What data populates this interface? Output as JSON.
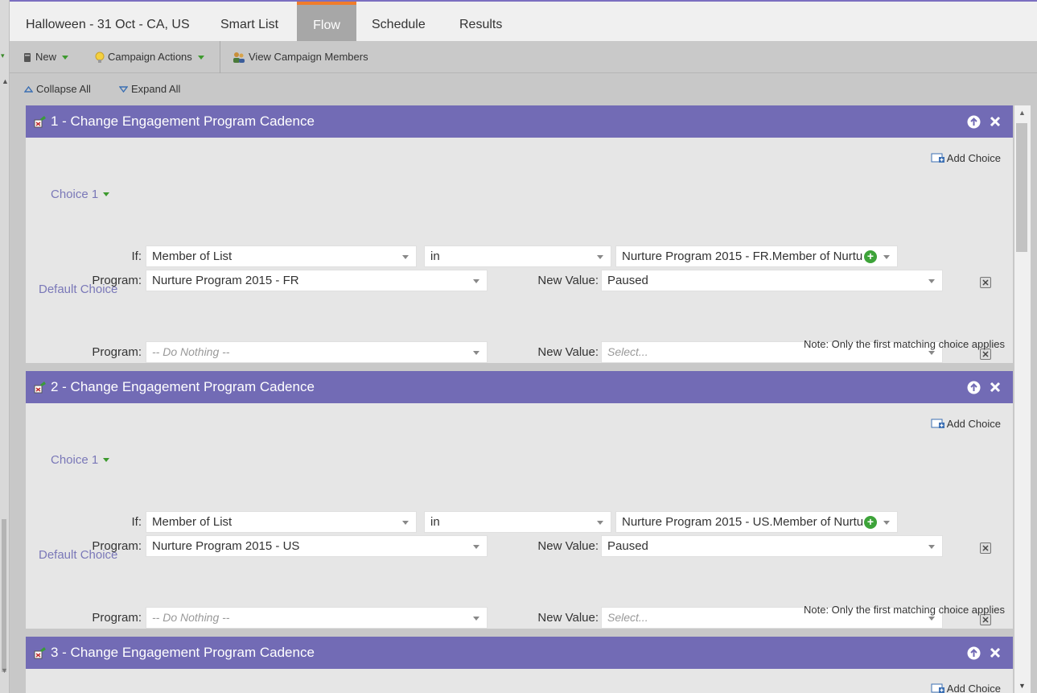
{
  "tabs": [
    {
      "label": "Halloween - 31 Oct - CA, US"
    },
    {
      "label": "Smart List"
    },
    {
      "label": "Flow"
    },
    {
      "label": "Schedule"
    },
    {
      "label": "Results"
    }
  ],
  "active_tab": "Flow",
  "toolbar": {
    "new_label": "New",
    "campaign_actions_label": "Campaign Actions",
    "view_members_label": "View Campaign Members"
  },
  "subbar": {
    "collapse_label": "Collapse All",
    "expand_label": "Expand All"
  },
  "common": {
    "add_choice": "Add Choice",
    "if_label": "If:",
    "program_label": "Program:",
    "new_value_label": "New Value:",
    "default_choice": "Default Choice",
    "note": "Note: Only the first matching choice applies",
    "do_nothing": "-- Do Nothing --",
    "select_placeholder": "Select..."
  },
  "steps": [
    {
      "title": "1 - Change Engagement Program Cadence",
      "choice_label": "Choice 1",
      "if_attribute": "Member of List",
      "if_operator": "in",
      "if_value": "Nurture Program 2015 - FR.Member of Nurtu",
      "program": "Nurture Program 2015 - FR",
      "new_value": "Paused"
    },
    {
      "title": "2 - Change Engagement Program Cadence",
      "choice_label": "Choice 1",
      "if_attribute": "Member of List",
      "if_operator": "in",
      "if_value": "Nurture Program 2015 - US.Member of Nurtu",
      "program": "Nurture Program 2015 - US",
      "new_value": "Paused"
    },
    {
      "title": "3 - Change Engagement Program Cadence"
    }
  ],
  "colors": {
    "header_purple": "#726bb5",
    "active_tab_accent": "#f07c2b",
    "add_green": "#3da339"
  }
}
